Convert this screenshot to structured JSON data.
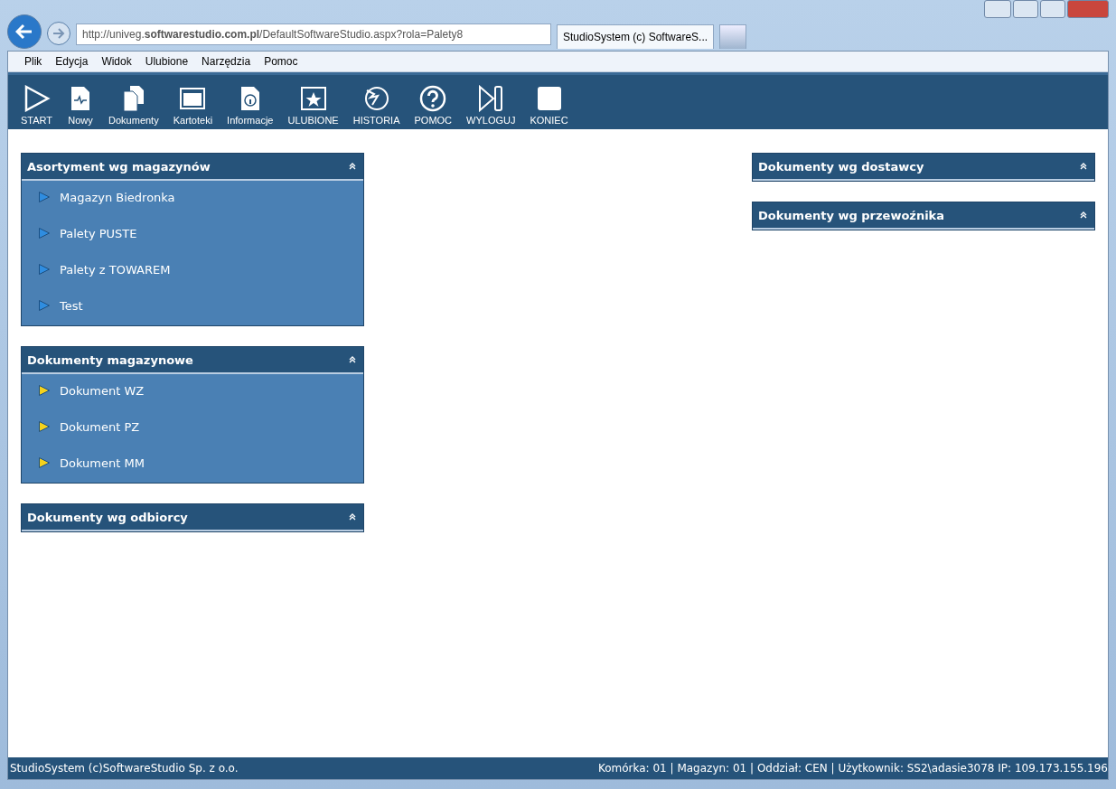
{
  "browser": {
    "address": "http://univeg.**softwarestudio.com.pl**/DefaultSoftwareStudio.aspx?rola=Palety8",
    "tabs": [
      {
        "title": "StudioSystem (c) SoftwareS...",
        "selected": true
      }
    ]
  },
  "menu": [
    "Plik",
    "Edycja",
    "Widok",
    "Ulubione",
    "Narzędzia",
    "Pomoc"
  ],
  "toolbar": [
    {
      "label": "START",
      "kind": "play"
    },
    {
      "label": "Nowy",
      "kind": "new"
    },
    {
      "label": "Dokumenty",
      "kind": "docs"
    },
    {
      "label": "Kartoteki",
      "kind": "window"
    },
    {
      "label": "Informacje",
      "kind": "info"
    },
    {
      "label": "ULUBIONE",
      "kind": "star"
    },
    {
      "label": "HISTORIA",
      "kind": "history"
    },
    {
      "label": "POMOC",
      "kind": "help"
    },
    {
      "label": "WYLOGUJ",
      "kind": "logout"
    },
    {
      "label": "KONIEC",
      "kind": "stop"
    }
  ],
  "columns": [
    [
      {
        "title": "Asortyment wg magazynów",
        "items": [
          {
            "label": "Magazyn Biedronka",
            "color": "#2f8de0"
          },
          {
            "label": "Palety PUSTE",
            "color": "#2f8de0"
          },
          {
            "label": "Palety z TOWAREM",
            "color": "#2f8de0"
          },
          {
            "label": "Test",
            "color": "#2f8de0"
          }
        ]
      },
      {
        "title": "Dokumenty magazynowe",
        "items": [
          {
            "label": "Dokument WZ",
            "color": "#f5d21c"
          },
          {
            "label": "Dokument PZ",
            "color": "#f5d21c"
          },
          {
            "label": "Dokument MM",
            "color": "#f5d21c"
          }
        ]
      },
      {
        "title": "Dokumenty wg odbiorcy"
      }
    ],
    [
      {
        "title": "Dokumenty wg dostawcy"
      },
      {
        "title": "Dokumenty wg przewoźnika"
      }
    ]
  ],
  "status_bar": {
    "left": "StudioSystem (c)SoftwareStudio Sp. z o.o.",
    "right": "Komórka: 01 | Magazyn: 01 | Oddział: CEN | Użytkownik: SS2\\adasie3078 IP: 109.173.155.196"
  }
}
